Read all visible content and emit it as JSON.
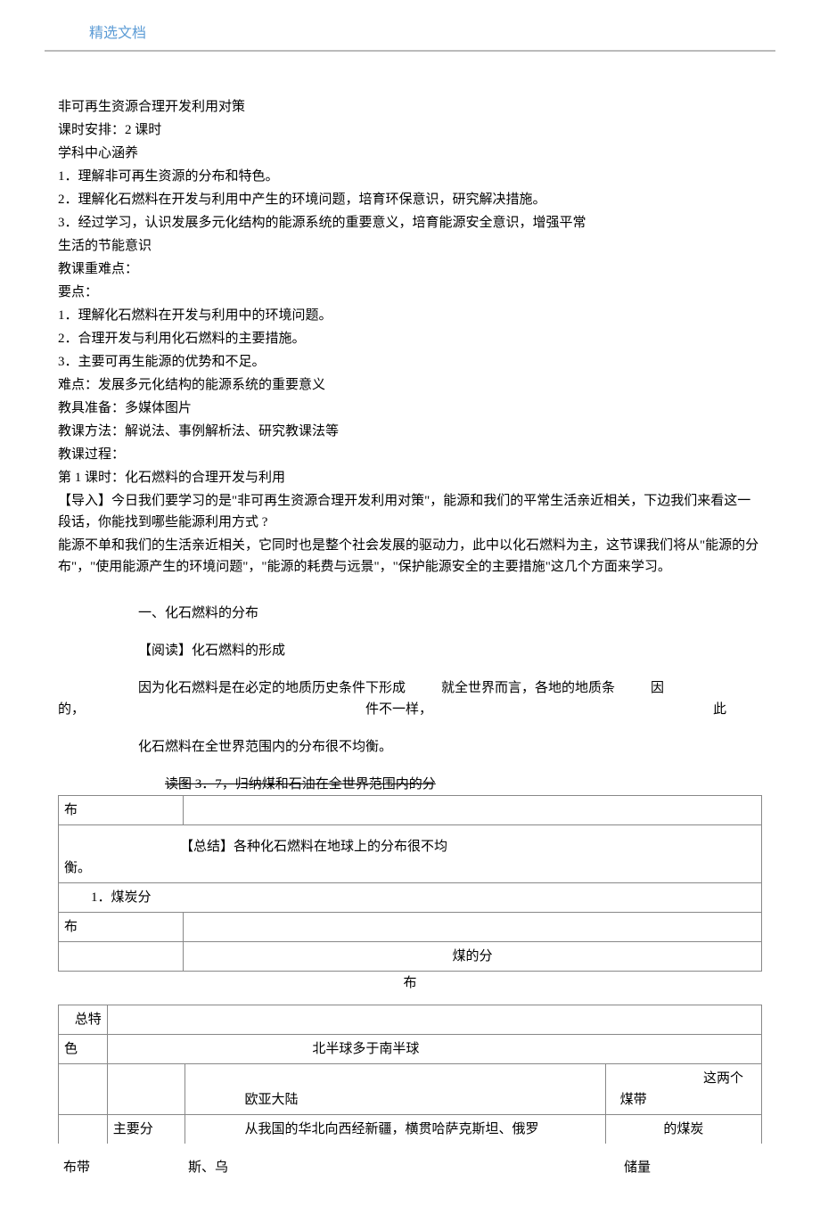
{
  "header": {
    "label": "精选文档"
  },
  "content": {
    "title": "非可再生资源合理开发利用对策",
    "schedule": "课时安排：2 课时",
    "subject_heading": "学科中心涵养",
    "objectives": [
      "1．理解非可再生资源的分布和特色。",
      "2．理解化石燃料在开发与利用中产生的环境问题，培育环保意识，研究解决措施。",
      "3．经过学习，认识发展多元化结构的能源系统的重要意义，培育能源安全意识，增强平常",
      "生活的节能意识"
    ],
    "keypoints_heading": "教课重难点：",
    "key_label": "要点：",
    "keypoints": [
      "1．理解化石燃料在开发与利用中的环境问题。",
      "2．合理开发与利用化石燃料的主要措施。",
      "3．主要可再生能源的优势和不足。"
    ],
    "difficulty": "难点：发展多元化结构的能源系统的重要意义",
    "materials": "教具准备：多媒体图片",
    "methods": "教课方法：解说法、事例解析法、研究教课法等",
    "process_heading": "教课过程：",
    "lesson1": "第 1 课时：化石燃料的合理开发与利用",
    "intro1": "【导入】今日我们要学习的是\"非可再生资源合理开发利用对策\"，能源和我们的平常生活亲近相关，下边我们来看这一段话，你能找到哪些能源利用方式 ?",
    "intro2": "能源不单和我们的生活亲近相关，它同时也是整个社会发展的驱动力，此中以化石燃料为主，这节课我们将从\"能源的分布\"，\"使用能源产生的环境问题\"，\"能源的耗费与远景\"，\"保护能源安全的主要措施\"这几个方面来学习。"
  },
  "section1": {
    "heading": "一、化石燃料的分布",
    "reading": "【阅读】化石燃料的形成",
    "para1_left": "因为化石燃料是在必定的地质历史条件下形成",
    "para1_mid": "就全世界而言，各地的地质条",
    "para1_right": "因",
    "para1b_left": "的，",
    "para1b_mid": "件不一样，",
    "para1b_right": "此",
    "para2": "化石燃料在全世界范围内的分布很不均衡。",
    "readfig": "读图 3．7，归纳煤和石油在全世界范围内的分"
  },
  "table1": {
    "r1c1": "布",
    "r2c1": "衡。",
    "r2c2": "【总结】各种化石燃料在地球上的分布很不均",
    "r3c1": "1．煤炭分",
    "r4c1": "布",
    "r5_title": "煤的分",
    "r5_sub": "布"
  },
  "table2": {
    "r1c1": "色",
    "r1c1_top": "总特",
    "r1c2": "北半球多于南半球",
    "r2c2a": "欧亚大陆",
    "r2c3a": "这两个",
    "r2c3b": "煤带",
    "r3c1": "布带",
    "r3c1b": "主要分",
    "r3c2": "从我国的华北向西经新疆，横贯哈萨克斯坦、俄罗",
    "r3c2b": "斯、乌",
    "r3c3": "的煤炭",
    "r3c3b": "储量"
  }
}
